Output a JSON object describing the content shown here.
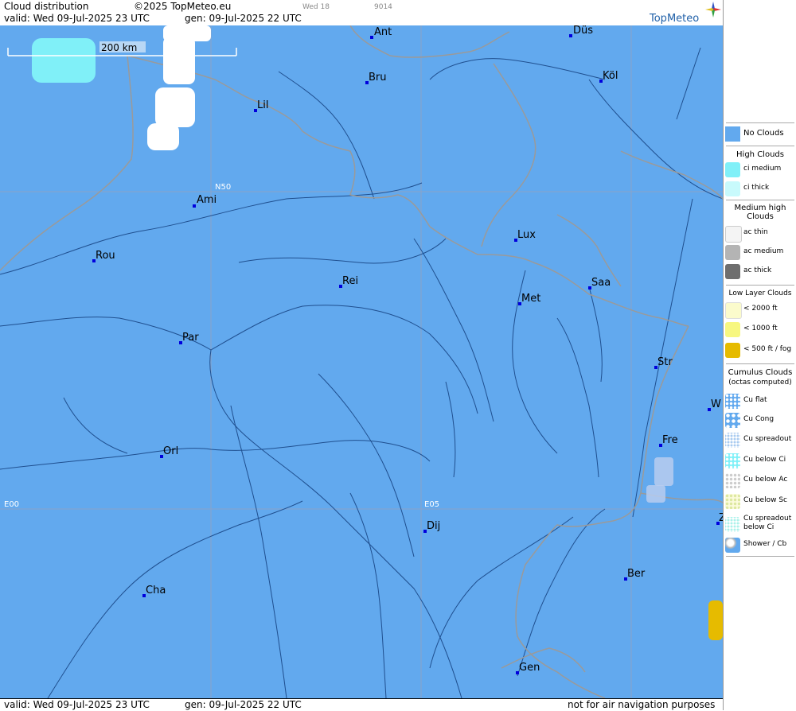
{
  "header": {
    "title": "Cloud distribution",
    "copyright": "©2025 TopMeteo.eu",
    "small_1": "Wed 18",
    "small_2": "9014",
    "valid": "valid:  Wed  09-Jul-2025  23 UTC",
    "gen": "gen: 09-Jul-2025 22 UTC",
    "logo": "TopMeteo"
  },
  "footer": {
    "valid": "valid:  Wed  09-Jul-2025  23 UTC",
    "gen": "gen: 09-Jul-2025 22 UTC",
    "disclaimer": "not for air navigation purposes"
  },
  "map": {
    "scale_label": "200 km",
    "grid_labels": {
      "n50": "N50",
      "e00": "E00",
      "e05": "E05"
    },
    "cities": [
      {
        "id": "ant",
        "name": "Ant"
      },
      {
        "id": "dus",
        "name": "Düs"
      },
      {
        "id": "bru",
        "name": "Bru"
      },
      {
        "id": "kol",
        "name": "Köl"
      },
      {
        "id": "lil",
        "name": "Lil"
      },
      {
        "id": "ami",
        "name": "Ami"
      },
      {
        "id": "rou",
        "name": "Rou"
      },
      {
        "id": "lux",
        "name": "Lux"
      },
      {
        "id": "rei",
        "name": "Rei"
      },
      {
        "id": "saa",
        "name": "Saa"
      },
      {
        "id": "met",
        "name": "Met"
      },
      {
        "id": "par",
        "name": "Par"
      },
      {
        "id": "str",
        "name": "Str"
      },
      {
        "id": "w",
        "name": "W"
      },
      {
        "id": "fre",
        "name": "Fre"
      },
      {
        "id": "orl",
        "name": "Orl"
      },
      {
        "id": "dij",
        "name": "Dij"
      },
      {
        "id": "ber",
        "name": "Ber"
      },
      {
        "id": "cha",
        "name": "Cha"
      },
      {
        "id": "gen",
        "name": "Gen"
      },
      {
        "id": "z",
        "name": "Z"
      }
    ],
    "colors": {
      "background": "#62a9ee",
      "border": "#9a9a9a",
      "river": "#1f4f8f",
      "city": "#0000dd",
      "grid": "#8aa4c8"
    }
  },
  "legend": {
    "no_clouds": "No Clouds",
    "high_title": "High Clouds",
    "ci_medium": "ci medium",
    "ci_thick": "ci thick",
    "medium_title": "Medium high Clouds",
    "ac_thin": "ac thin",
    "ac_medium": "ac medium",
    "ac_thick": "ac thick",
    "low_title": "Low Layer Clouds",
    "low_2000": "< 2000 ft",
    "low_1000": "< 1000 ft",
    "low_500": "< 500 ft / fog",
    "cumulus_title": "Cumulus Clouds",
    "cumulus_sub": "(octas computed)",
    "cu_flat": "Cu flat",
    "cu_cong": "Cu Cong",
    "cu_spreadout": "Cu spreadout",
    "cu_below_ci": "Cu below Ci",
    "cu_below_ac": "Cu below Ac",
    "cu_below_sc": "Cu below Sc",
    "cu_spreadout_below_ci": "Cu spreadout below Ci",
    "shower_cb": "Shower / Cb"
  }
}
